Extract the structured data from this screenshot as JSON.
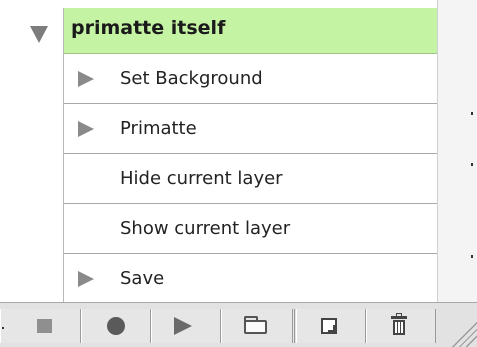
{
  "group": {
    "title": "primatte itself",
    "expanded": true,
    "header_color": "#c5f3a4"
  },
  "items": [
    {
      "label": "Set Background",
      "has_submenu": true
    },
    {
      "label": "Primatte",
      "has_submenu": true
    },
    {
      "label": "Hide current layer",
      "has_submenu": false
    },
    {
      "label": "Show current layer",
      "has_submenu": false
    },
    {
      "label": "Save",
      "has_submenu": true
    }
  ],
  "toolbar": {
    "buttons": [
      {
        "icon": "stop-icon"
      },
      {
        "icon": "record-icon"
      },
      {
        "icon": "play-icon"
      },
      {
        "icon": "folder-icon"
      },
      {
        "icon": "new-document-icon"
      },
      {
        "icon": "trash-icon"
      }
    ]
  }
}
